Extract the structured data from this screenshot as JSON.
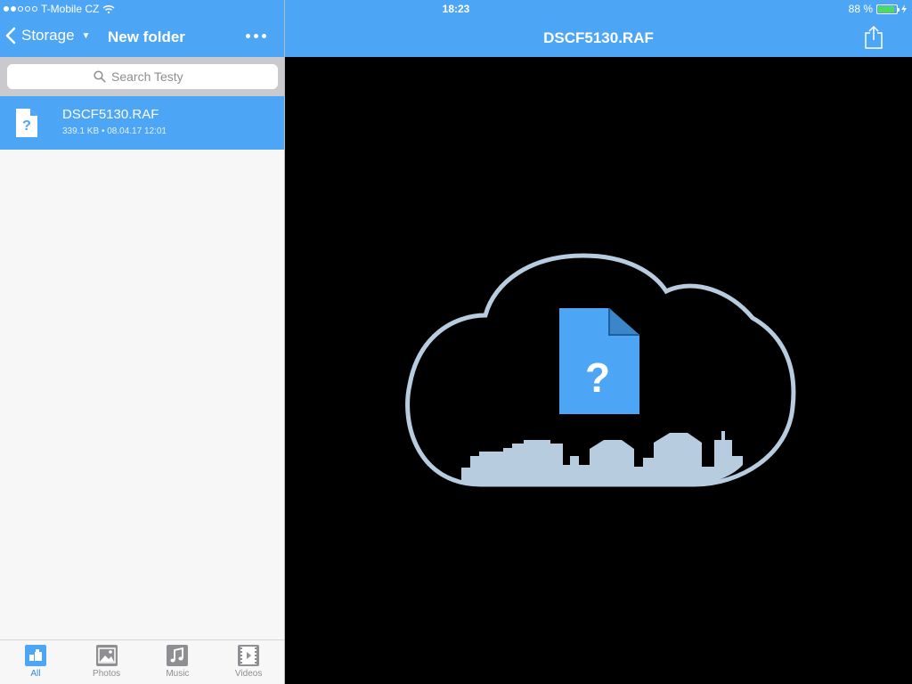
{
  "status_bar": {
    "carrier": "T-Mobile CZ",
    "time": "18:23",
    "battery": "88 %",
    "battery_level": 0.88
  },
  "left_nav": {
    "back_label": "Storage",
    "title": "New folder"
  },
  "search": {
    "placeholder": "Search Testy"
  },
  "files": [
    {
      "name": "DSCF5130.RAF",
      "size": "339.1 KB",
      "separator": "•",
      "date": "08.04.17 12:01"
    }
  ],
  "tabs": [
    {
      "label": "All",
      "icon": "all-icon",
      "active": true
    },
    {
      "label": "Photos",
      "icon": "photos-icon",
      "active": false
    },
    {
      "label": "Music",
      "icon": "music-icon",
      "active": false
    },
    {
      "label": "Videos",
      "icon": "videos-icon",
      "active": false
    }
  ],
  "viewer": {
    "title": "DSCF5130.RAF",
    "placeholder_glyph": "?"
  },
  "colors": {
    "accent": "#4da6f5",
    "cloud": "#b8cce0",
    "doc": "#4da6f5"
  }
}
